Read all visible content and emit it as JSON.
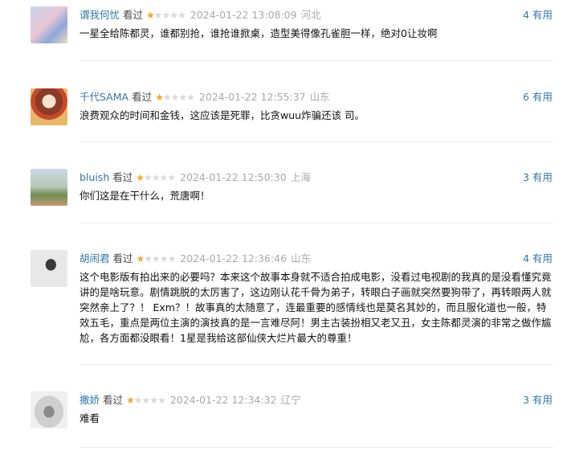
{
  "comments": [
    {
      "user": "谓我何忧",
      "status": "看过",
      "stars_on": "★",
      "stars_off": "★★★★",
      "time": "2024-01-22 13:08:09",
      "location": "河北",
      "useful": "4 有用",
      "text": "一星全给陈都灵，谁都别抢，谁抢谁掀桌，造型美得像孔雀胆一样，绝对0让妆啊"
    },
    {
      "user": "千代SAMA",
      "status": "看过",
      "stars_on": "★",
      "stars_off": "★★★★",
      "time": "2024-01-22 12:55:37",
      "location": "山东",
      "useful": "6 有用",
      "text": "浪费观众的时间和金钱，这应该是死罪，比贪wuu炸骗还该 司。"
    },
    {
      "user": "bluish",
      "status": "看过",
      "stars_on": "★",
      "stars_off": "★★★★",
      "time": "2024-01-22 12:50:30",
      "location": "上海",
      "useful": "3 有用",
      "text": "你们这是在干什么，荒唐啊！"
    },
    {
      "user": "胡闹君",
      "status": "看过",
      "stars_on": "★",
      "stars_off": "★★★★",
      "time": "2024-01-22 12:36:46",
      "location": "山东",
      "useful": "4 有用",
      "text": "这个电影版有拍出来的必要吗？本来这个故事本身就不适合拍成电影，没看过电视剧的我真的是没看懂究竟讲的是啥玩意。剧情跳脱的太厉害了，这边刚认花千骨为弟子，转眼白子画就突然要狗带了，再转眼两人就突然亲上了？！ Exm？！故事真的太随意了，连最重要的感情线也是莫名其妙的，而且服化道也一般，特效五毛，重点是两位主演的演技真的是一言难尽阿！男主古装扮相又老又丑，女主陈都灵演的非常之做作尴尬，各方面都没眼看！1星是我给这部仙侠大烂片最大的尊重！"
    },
    {
      "user": "撒娇",
      "status": "看过",
      "stars_on": "★",
      "stars_off": "★★★★",
      "time": "2024-01-22 12:34:32",
      "location": "辽宁",
      "useful": "3 有用",
      "text": "难看"
    }
  ],
  "colors": {
    "link": "#3377aa",
    "star_on": "#f5a623",
    "star_off": "#d9d9d9",
    "muted": "#aaaaaa"
  }
}
